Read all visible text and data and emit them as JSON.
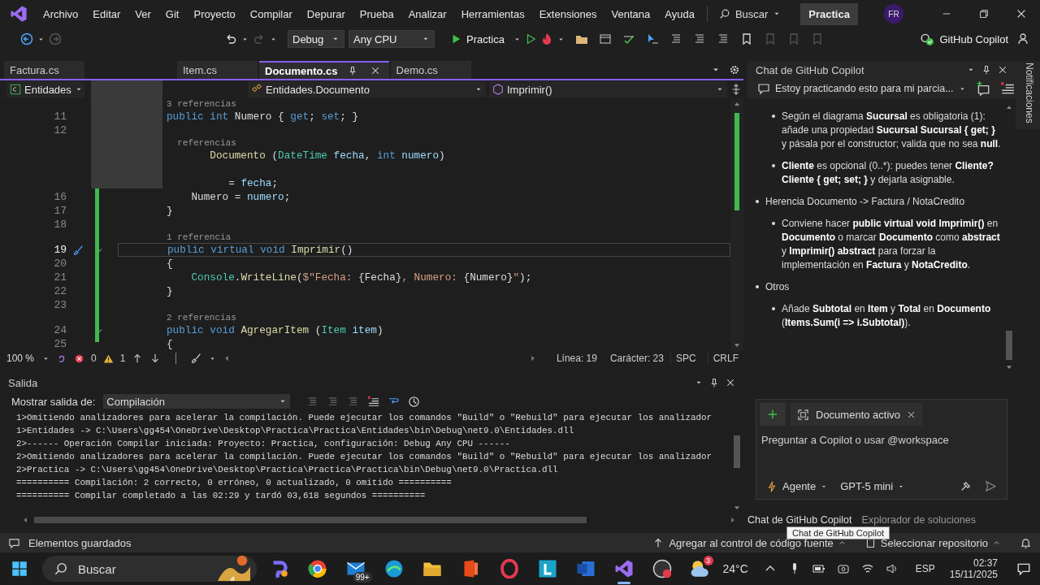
{
  "menu": {
    "items": [
      "Archivo",
      "Editar",
      "Ver",
      "Git",
      "Proyecto",
      "Compilar",
      "Depurar",
      "Prueba",
      "Analizar",
      "Herramientas",
      "Extensiones",
      "Ventana",
      "Ayuda"
    ],
    "search": "Buscar",
    "solution": "Practica",
    "avatar": "FR"
  },
  "toolbar": {
    "configuration": "Debug",
    "platform": "Any CPU",
    "run_target": "Practica",
    "copilot": "GitHub Copilot"
  },
  "tabs": [
    {
      "label": "Factura.cs",
      "selected": false
    },
    {
      "label": "Item.cs",
      "selected": false
    },
    {
      "label": "Documento.cs",
      "selected": true
    },
    {
      "label": "Demo.cs",
      "selected": false
    }
  ],
  "breadcrumbs": [
    "Entidades",
    "Entidades.Documento",
    "Imprimir()"
  ],
  "code": [
    {
      "kind": "lens",
      "text": "3 referencias"
    },
    {
      "kind": "code",
      "number": "11",
      "current": false,
      "foldable": false,
      "segments": [
        {
          "kind": "kw",
          "text": "public int "
        },
        {
          "kind": "plain",
          "text": "Numero { "
        },
        {
          "kind": "kw",
          "text": "get"
        },
        {
          "kind": "plain",
          "text": "; "
        },
        {
          "kind": "kw",
          "text": "set"
        },
        {
          "kind": "plain",
          "text": "; }"
        }
      ]
    },
    {
      "kind": "code",
      "number": "12",
      "current": false,
      "foldable": false
    },
    {
      "kind": "lens",
      "text": "  referencias"
    },
    {
      "kind": "code",
      "segments": [
        {
          "kind": "method",
          "text": "       Documento"
        },
        {
          "kind": "plain",
          "text": " ("
        },
        {
          "kind": "type",
          "text": "DateTime"
        },
        {
          "kind": "param",
          "text": " fecha"
        },
        {
          "kind": "plain",
          "text": ", "
        },
        {
          "kind": "kw",
          "text": "int"
        },
        {
          "kind": "param",
          "text": " numero"
        },
        {
          "kind": "plain",
          "text": ")"
        }
      ]
    },
    {
      "kind": "code"
    },
    {
      "kind": "code",
      "segments": [
        {
          "kind": "plain",
          "text": "          = "
        },
        {
          "kind": "param",
          "text": "fecha"
        },
        {
          "kind": "plain",
          "text": ";"
        }
      ]
    },
    {
      "kind": "code",
      "number": "16",
      "current": false,
      "foldable": false,
      "segments": [
        {
          "kind": "plain",
          "text": "    Numero = "
        },
        {
          "kind": "param",
          "text": "numero"
        },
        {
          "kind": "plain",
          "text": ";"
        }
      ]
    },
    {
      "kind": "code",
      "number": "17",
      "current": false,
      "foldable": false,
      "segments": [
        {
          "kind": "plain",
          "text": "}"
        }
      ]
    },
    {
      "kind": "code",
      "number": "18",
      "current": false,
      "foldable": false
    },
    {
      "kind": "lens",
      "text": "1 referencia"
    },
    {
      "kind": "code",
      "number": "19",
      "current": true,
      "foldable": true,
      "segments": [
        {
          "kind": "kw",
          "text": "public virtual void "
        },
        {
          "kind": "method",
          "text": "Imprimir"
        },
        {
          "kind": "plain",
          "text": "()"
        }
      ]
    },
    {
      "kind": "code",
      "number": "20",
      "current": false,
      "foldable": false,
      "segments": [
        {
          "kind": "plain",
          "text": "{"
        }
      ]
    },
    {
      "kind": "code",
      "number": "21",
      "current": false,
      "foldable": false,
      "segments": [
        {
          "kind": "type",
          "text": "    Console"
        },
        {
          "kind": "plain",
          "text": "."
        },
        {
          "kind": "method",
          "text": "WriteLine"
        },
        {
          "kind": "plain",
          "text": "("
        },
        {
          "kind": "str",
          "text": "$\"Fecha: "
        },
        {
          "kind": "plain",
          "text": "{Fecha}"
        },
        {
          "kind": "str",
          "text": ", Numero: "
        },
        {
          "kind": "plain",
          "text": "{Numero}"
        },
        {
          "kind": "str",
          "text": "\""
        },
        {
          "kind": "plain",
          "text": ");"
        }
      ]
    },
    {
      "kind": "code",
      "number": "22",
      "current": false,
      "foldable": false,
      "segments": [
        {
          "kind": "plain",
          "text": "}"
        }
      ]
    },
    {
      "kind": "code",
      "number": "23",
      "current": false,
      "foldable": false
    },
    {
      "kind": "lens",
      "text": "2 referencias"
    },
    {
      "kind": "code",
      "number": "24",
      "current": false,
      "foldable": true,
      "segments": [
        {
          "kind": "kw",
          "text": "public void "
        },
        {
          "kind": "method",
          "text": "AgregarItem"
        },
        {
          "kind": "plain",
          "text": " ("
        },
        {
          "kind": "type",
          "text": "Item"
        },
        {
          "kind": "param",
          "text": " item"
        },
        {
          "kind": "plain",
          "text": ")"
        }
      ]
    },
    {
      "kind": "code",
      "number": "25",
      "current": false,
      "foldable": false,
      "segments": [
        {
          "kind": "plain",
          "text": "{"
        }
      ]
    }
  ],
  "editor_status": {
    "zoom": "100 %",
    "errors": "0",
    "warnings": "1",
    "line": "Línea: 19",
    "column": "Carácter: 23",
    "indent": "SPC",
    "line_ending": "CRLF"
  },
  "output": {
    "title": "Salida",
    "source_label": "Mostrar salida de:",
    "source": "Compilación",
    "lines": [
      "1>Omitiendo analizadores para acelerar la compilación. Puede ejecutar los comandos \"Build\" o \"Rebuild\" para ejecutar los analizador",
      "1>Entidades -> C:\\Users\\gg454\\OneDrive\\Desktop\\Practica\\Practica\\Entidades\\bin\\Debug\\net9.0\\Entidades.dll",
      "2>------ Operación Compilar iniciada: Proyecto: Practica, configuración: Debug Any CPU ------",
      "2>Omitiendo analizadores para acelerar la compilación. Puede ejecutar los comandos \"Build\" o \"Rebuild\" para ejecutar los analizador",
      "2>Practica -> C:\\Users\\gg454\\OneDrive\\Desktop\\Practica\\Practica\\Practica\\bin\\Debug\\net9.0\\Practica.dll",
      "========== Compilación: 2 correcto, 0 erróneo, 0 actualizado, 0 omitido ==========",
      "========== Compilar completado a las 02:29 y tardó 03,618 segundos =========="
    ]
  },
  "chat": {
    "title": "Chat de GitHub Copilot",
    "thread": "Estoy practicando esto para mi parcia...",
    "messages": [
      {
        "children": [
          {
            "text": "Según el diagrama **Sucursal** es obligatoria (1): añade una propiedad **Sucursal Sucursal { get; }** y pásala por el constructor; valida que no sea **null**."
          },
          {
            "text": "**Cliente** es opcional (0..*): puedes tener **Cliente? Cliente { get; set; }** y dejarla asignable."
          }
        ]
      },
      {
        "text": "Herencia Documento -> Factura / NotaCredito",
        "children": [
          {
            "text": "Conviene hacer **public virtual void Imprimir()** en **Documento** o marcar **Documento** como **abstract** y **Imprimir() abstract** para forzar la implementación en **Factura** y **NotaCredito**."
          }
        ]
      },
      {
        "text": "Otros",
        "children": [
          {
            "text": "Añade **Subtotal** en **Item** y **Total** en **Documento** (**Items.Sum(i => i.Subtotal)**)."
          }
        ]
      }
    ],
    "context_chip": "Documento activo",
    "placeholder": "Preguntar a Copilot o usar @workspace",
    "mode": "Agente",
    "model": "GPT-5 mini"
  },
  "side_tabs": [
    {
      "label": "Chat de GitHub Copilot",
      "selected": true
    },
    {
      "label": "Explorador de soluciones",
      "selected": false
    }
  ],
  "tooltip": "Chat de GitHub Copilot",
  "notifications": "Notificaciones",
  "status_bar": {
    "message": "Elementos guardados",
    "source_control": "Agregar al control de código fuente",
    "repository": "Seleccionar repositorio"
  },
  "taskbar": {
    "search": "Buscar",
    "mail_badge": "99+",
    "weather_badge": "3",
    "temperature": "24°C",
    "language": "ESP",
    "time": "02:37",
    "date": "15/11/2025"
  }
}
